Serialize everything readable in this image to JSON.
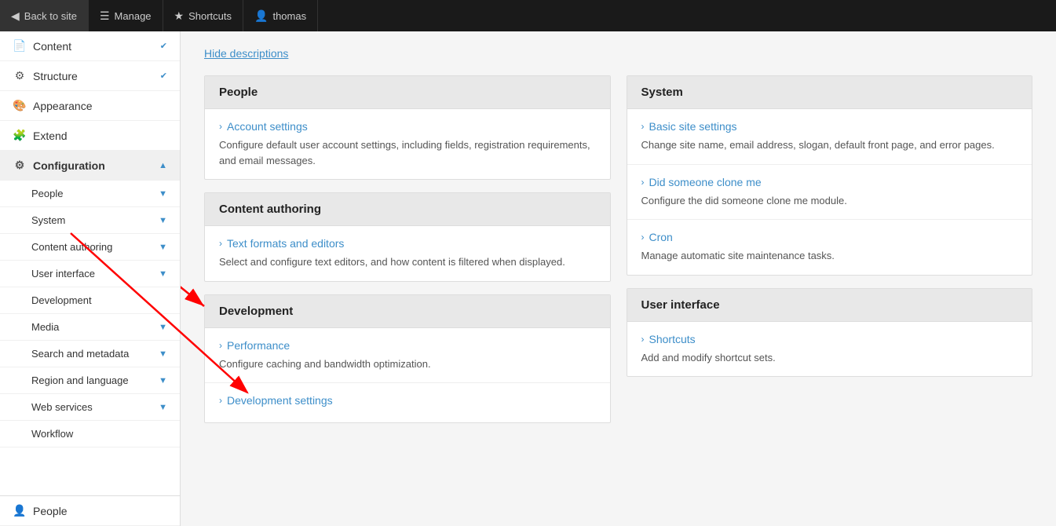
{
  "topbar": {
    "back_label": "Back to site",
    "manage_label": "Manage",
    "shortcuts_label": "Shortcuts",
    "user_label": "thomas"
  },
  "sidebar": {
    "items": [
      {
        "id": "content",
        "label": "Content",
        "icon": "📄",
        "has_expand": true
      },
      {
        "id": "structure",
        "label": "Structure",
        "icon": "🔧",
        "has_expand": true
      },
      {
        "id": "appearance",
        "label": "Appearance",
        "icon": "🎨",
        "has_expand": false
      },
      {
        "id": "extend",
        "label": "Extend",
        "icon": "🧩",
        "has_expand": false
      },
      {
        "id": "configuration",
        "label": "Configuration",
        "icon": "⚙",
        "active": true,
        "has_expand": true
      }
    ],
    "sub_items": [
      {
        "id": "people",
        "label": "People",
        "has_arrow": true
      },
      {
        "id": "system",
        "label": "System",
        "has_arrow": true
      },
      {
        "id": "content_authoring",
        "label": "Content authoring",
        "has_arrow": true
      },
      {
        "id": "user_interface",
        "label": "User interface",
        "has_arrow": true
      },
      {
        "id": "development",
        "label": "Development",
        "has_arrow": false
      },
      {
        "id": "media",
        "label": "Media",
        "has_arrow": true
      },
      {
        "id": "search_and_metadata",
        "label": "Search and metadata",
        "has_arrow": true
      },
      {
        "id": "region_and_language",
        "label": "Region and language",
        "has_arrow": true
      },
      {
        "id": "web_services",
        "label": "Web services",
        "has_arrow": true
      },
      {
        "id": "workflow",
        "label": "Workflow",
        "has_arrow": false
      }
    ],
    "bottom_item": {
      "id": "people_bottom",
      "label": "People",
      "icon": "👤"
    }
  },
  "main": {
    "hide_descriptions": "Hide descriptions",
    "left_sections": [
      {
        "id": "people",
        "header": "People",
        "items": [
          {
            "title": "Account settings",
            "desc": "Configure default user account settings, including fields, registration requirements, and email messages."
          }
        ]
      },
      {
        "id": "content_authoring",
        "header": "Content authoring",
        "items": [
          {
            "title": "Text formats and editors",
            "desc": "Select and configure text editors, and how content is filtered when displayed."
          }
        ]
      },
      {
        "id": "development",
        "header": "Development",
        "items": [
          {
            "title": "Performance",
            "desc": "Configure caching and bandwidth optimization."
          },
          {
            "title": "Development settings",
            "desc": ""
          }
        ]
      }
    ],
    "right_sections": [
      {
        "id": "system",
        "header": "System",
        "items": [
          {
            "title": "Basic site settings",
            "desc": "Change site name, email address, slogan, default front page, and error pages."
          },
          {
            "title": "Did someone clone me",
            "desc": "Configure the did someone clone me module."
          },
          {
            "title": "Cron",
            "desc": "Manage automatic site maintenance tasks."
          }
        ]
      },
      {
        "id": "user_interface",
        "header": "User interface",
        "items": [
          {
            "title": "Shortcuts",
            "desc": "Add and modify shortcut sets."
          }
        ]
      }
    ]
  }
}
